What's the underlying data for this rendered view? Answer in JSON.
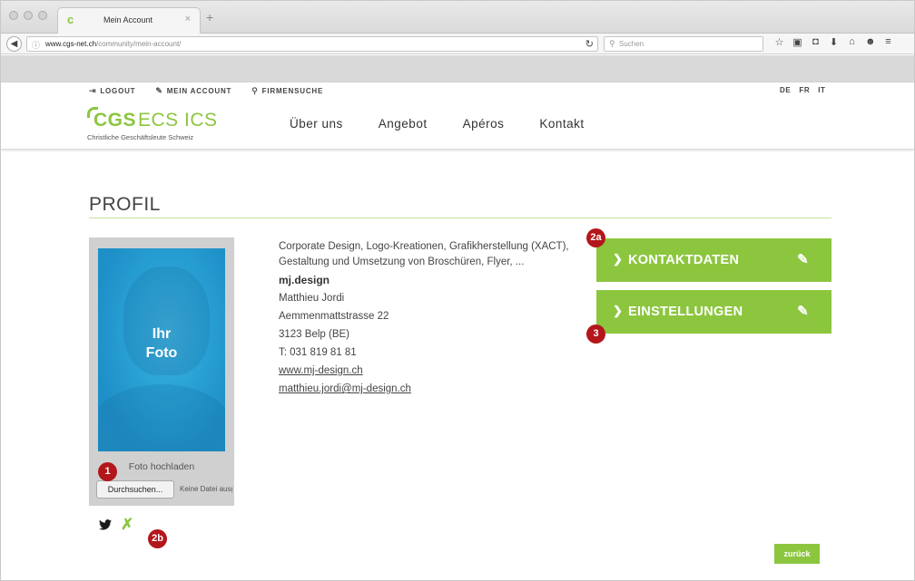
{
  "browser": {
    "tab_title": "Mein Account",
    "tab_favicon": "c",
    "tab_close": "×",
    "new_tab": "+",
    "url_domain": "www.cgs-net.ch",
    "url_path": "/community/mein-account/",
    "search_placeholder": "Suchen",
    "toolbar_icons": [
      "star-icon",
      "clipboard-icon",
      "pocket-icon",
      "download-icon",
      "home-icon",
      "chat-icon",
      "menu-icon"
    ],
    "toolbar_glyphs": [
      "☆",
      "▣",
      "◘",
      "⬇",
      "⌂",
      "☻",
      "≡"
    ]
  },
  "header": {
    "utility": {
      "logout": "LOGOUT",
      "account": "MEIN ACCOUNT",
      "company_search": "FIRMENSUCHE"
    },
    "languages": [
      "DE",
      "FR",
      "IT"
    ],
    "logo": {
      "cgs": "CGS",
      "ecs": "ECS ICS",
      "subtitle": "Christliche Geschäftsleute Schweiz"
    },
    "nav": [
      "Über uns",
      "Angebot",
      "Apéros",
      "Kontakt"
    ]
  },
  "profile": {
    "title": "PROFIL",
    "photo_label_1": "Ihr",
    "photo_label_2": "Foto",
    "upload_label": "Foto hochladen",
    "browse_button": "Durchsuchen...",
    "file_status": "Keine Datei ausgewählt.",
    "description": "Corporate Design, Logo-Kreationen, Grafikherstellung (XACT), Gestaltung und Umsetzung von Broschüren, Flyer, ...",
    "company": "mj.design",
    "name": "Matthieu Jordi",
    "street": "Aemmenmattstrasse 22",
    "city": "3123 Belp (BE)",
    "phone": "T: 031 819 81 81",
    "website": "www.mj-design.ch",
    "email": "matthieu.jordi@mj-design.ch"
  },
  "actions": {
    "contact": "KONTAKTDATEN",
    "settings": "EINSTELLUNGEN",
    "back": "zurück"
  },
  "markers": {
    "m1": "1",
    "m2a": "2a",
    "m2b": "2b",
    "m3": "3"
  },
  "colors": {
    "accent": "#8cc63f",
    "marker": "#b3171b",
    "photo_blue": "#2aa3d6"
  }
}
